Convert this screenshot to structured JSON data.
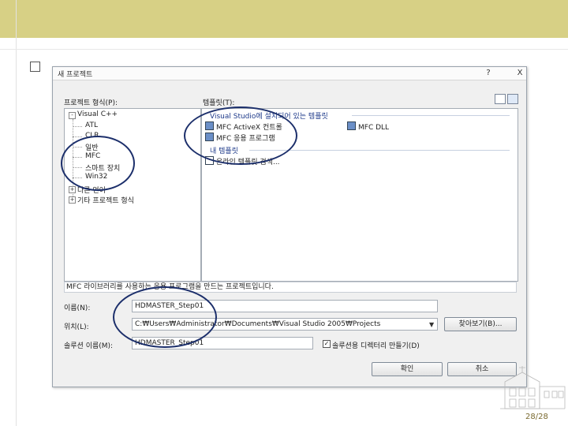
{
  "dialog": {
    "title": "새 프로젝트",
    "help_glyph": "?",
    "close_glyph": "X",
    "project_types_label": "프로젝트 형식(P):",
    "templates_label": "템플릿(T):",
    "tree": [
      {
        "label": "Visual C++",
        "expander": "-"
      },
      {
        "label": "ATL"
      },
      {
        "label": "CLR"
      },
      {
        "label": "일반"
      },
      {
        "label": "MFC"
      },
      {
        "label": "스마트 장치"
      },
      {
        "label": "Win32"
      },
      {
        "label": "다른 언어",
        "expander": "+"
      },
      {
        "label": "기타 프로젝트 형식",
        "expander": "+"
      }
    ],
    "templates": {
      "installed_header": "Visual Studio에 설치되어 있는 템플릿",
      "items": [
        "MFC ActiveX 컨트롤",
        "MFC DLL",
        "MFC 응용 프로그램"
      ],
      "my_header": "내 템플릿",
      "my_items": [
        "온라인 템플릿 검색..."
      ]
    },
    "description": "MFC 라이브러리를 사용하는 응용 프로그램을 만드는 프로젝트입니다.",
    "name_label": "이름(N):",
    "name_value": "HDMASTER_Step01",
    "location_label": "위치(L):",
    "location_value": "C:₩Users₩Administrator₩Documents₩Visual Studio 2005₩Projects",
    "solution_label": "솔루션 이름(M):",
    "solution_value": "HDMASTER_Step01",
    "browse_label": "찾아보기(B)...",
    "create_dir_label": "솔루션용 디렉터리 만들기(D)",
    "create_dir_checked": true,
    "ok_label": "확인",
    "cancel_label": "취소"
  },
  "page_number": "28/28",
  "colors": {
    "top_band": "#d7d085",
    "annotation_circle": "#1c2f6b"
  }
}
